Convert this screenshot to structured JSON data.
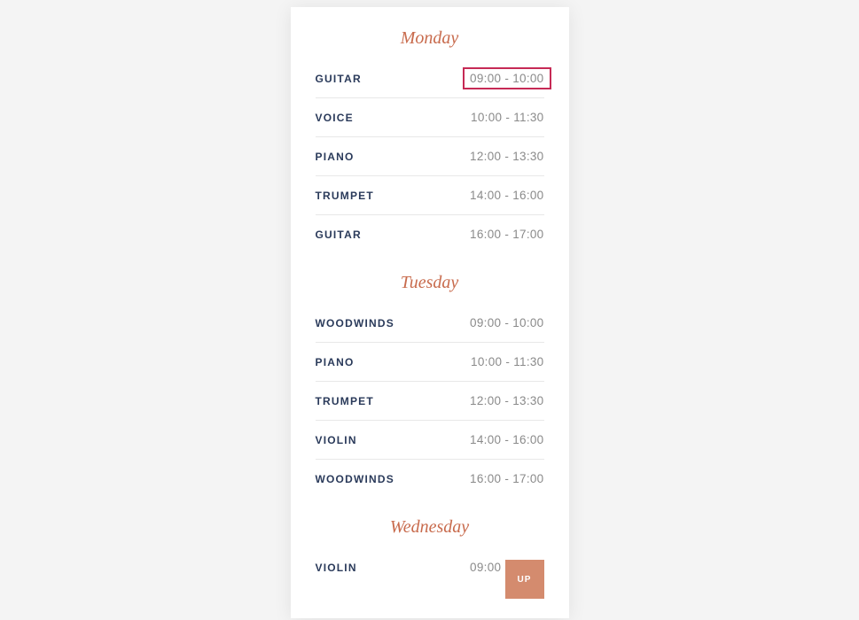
{
  "up_label": "UP",
  "days": [
    {
      "title": "Monday",
      "rows": [
        {
          "name": "GUITAR",
          "time": "09:00 - 10:00",
          "highlight": true
        },
        {
          "name": "VOICE",
          "time": "10:00 - 11:30"
        },
        {
          "name": "PIANO",
          "time": "12:00 - 13:30"
        },
        {
          "name": "TRUMPET",
          "time": "14:00 - 16:00"
        },
        {
          "name": "GUITAR",
          "time": "16:00 - 17:00"
        }
      ]
    },
    {
      "title": "Tuesday",
      "rows": [
        {
          "name": "WOODWINDS",
          "time": "09:00 - 10:00"
        },
        {
          "name": "PIANO",
          "time": "10:00 - 11:30"
        },
        {
          "name": "TRUMPET",
          "time": "12:00 - 13:30"
        },
        {
          "name": "VIOLIN",
          "time": "14:00 - 16:00"
        },
        {
          "name": "WOODWINDS",
          "time": "16:00 - 17:00"
        }
      ]
    },
    {
      "title": "Wednesday",
      "rows": [
        {
          "name": "VIOLIN",
          "time": "09:00 - 10:00"
        }
      ]
    }
  ]
}
